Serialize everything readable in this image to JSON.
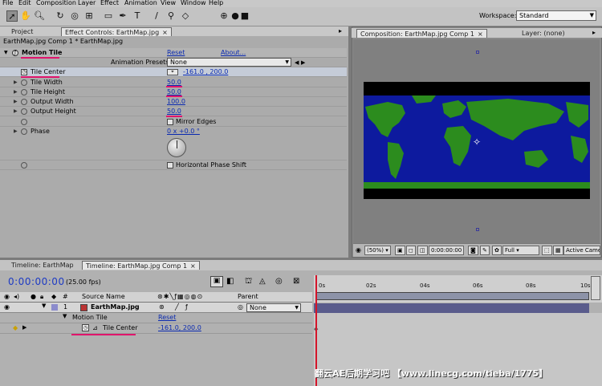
{
  "menu": [
    "File",
    "Edit",
    "Composition",
    "Layer",
    "Effect",
    "Animation",
    "View",
    "Window",
    "Help"
  ],
  "toolbar": {
    "tools": [
      "selection-tool",
      "hand-tool",
      "zoom-tool",
      "rotate-tool",
      "orbit-camera-tool",
      "pan-behind-tool",
      "rectangle-mask-tool",
      "pen-tool",
      "type-tool",
      "brush-tool",
      "clone-stamp-tool",
      "eraser-tool"
    ],
    "workspace_label": "Workspace:",
    "workspace_value": "Standard"
  },
  "left_panel": {
    "tabs": [
      "Project",
      "Effect Controls: EarthMap.jpg"
    ],
    "subtitle": "EarthMap.jpg Comp 1 * EarthMap.jpg",
    "effect_name": "Motion Tile",
    "reset": "Reset",
    "about": "About...",
    "presets_label": "Animation Presets:",
    "presets_value": "None",
    "params": [
      {
        "label": "Tile Center",
        "value": "-161.0 , 200.0"
      },
      {
        "label": "Tile Width",
        "value": "50.0"
      },
      {
        "label": "Tile Height",
        "value": "50.0"
      },
      {
        "label": "Output Width",
        "value": "100.0"
      },
      {
        "label": "Output Height",
        "value": "50.0"
      }
    ],
    "mirror_edges": "Mirror Edges",
    "phase_label": "Phase",
    "phase_value": "0 x +0.0 °",
    "horizontal_phase_shift": "Horizontal Phase Shift"
  },
  "comp_panel": {
    "tab": "Composition: EarthMap.jpg Comp 1",
    "layer_tab": "Layer: (none)",
    "zoom": "(50%)",
    "timecode": "0:00:00:00",
    "resolution": "Full",
    "camera": "Active Came"
  },
  "timeline": {
    "tabs": [
      "Timeline: EarthMap",
      "Timeline: EarthMap.jpg Comp 1"
    ],
    "timecode": "0:00:00:00",
    "fps": "(25.00 fps)",
    "col_num": "#",
    "col_source": "Source Name",
    "col_parent": "Parent",
    "layer_num": "1",
    "layer_name": "EarthMap.jpg",
    "parent_value": "None",
    "effect_row": "Motion Tile",
    "effect_reset": "Reset",
    "prop_row": "Tile Center",
    "prop_value": "-161.0, 200.0",
    "ruler": [
      "0s",
      "02s",
      "04s",
      "06s",
      "08s",
      "10s"
    ]
  },
  "watermark": "翻云AE后期学习吧 【www.linecg.com/tieba/1775】",
  "colors": {
    "accent_pink": "#e0156c",
    "timecode_blue": "#1d3ac4",
    "map_ocean": "#0d1a9e",
    "map_land": "#2c8c1e"
  }
}
